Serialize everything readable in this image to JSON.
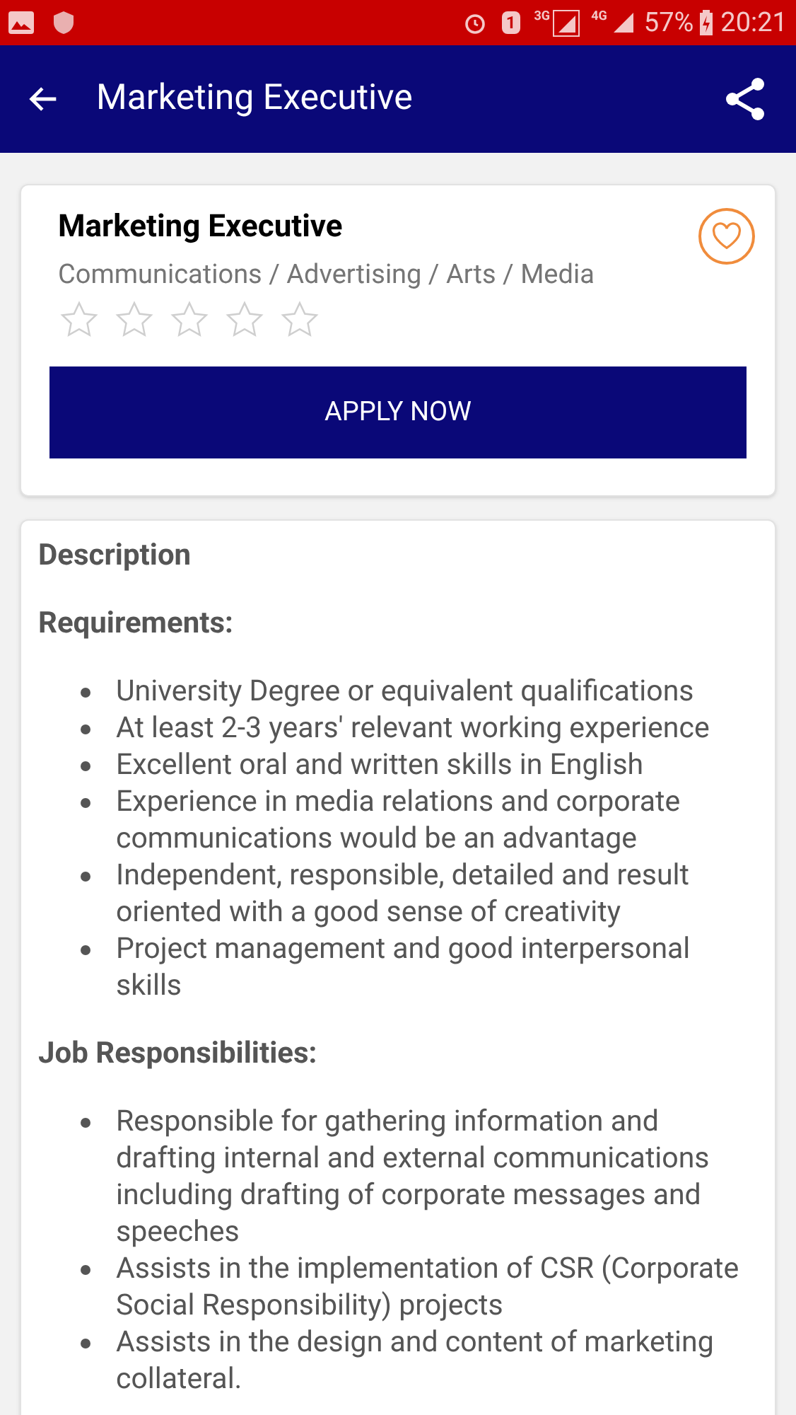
{
  "status_bar": {
    "network_3g": "3G",
    "network_4g": "4G",
    "sim": "1",
    "battery": "57%",
    "time": "20:21"
  },
  "app_bar": {
    "title": "Marketing Executive"
  },
  "job": {
    "title": "Marketing Executive",
    "category": "Communications / Advertising / Arts / Media",
    "stars": 0,
    "favorite": false,
    "apply_button": "APPLY NOW"
  },
  "details": {
    "heading": "Description",
    "sections": [
      {
        "title": "Requirements:",
        "items": [
          "University Degree or equivalent qualifications",
          "At least 2-3 years' relevant working experience",
          "Excellent oral and written skills in English",
          "Experience in media relations and corporate communications would be an advantage",
          "Independent, responsible, detailed and result oriented with a good sense of creativity",
          "Project management and good interpersonal skills"
        ]
      },
      {
        "title": "Job Responsibilities:",
        "items": [
          "Responsible for gathering information and drafting internal and external communications including drafting of corporate messages and speeches",
          "Assists in the implementation of CSR (Corporate Social Responsibility) projects",
          "Assists in the design and content of marketing collateral."
        ]
      }
    ]
  }
}
